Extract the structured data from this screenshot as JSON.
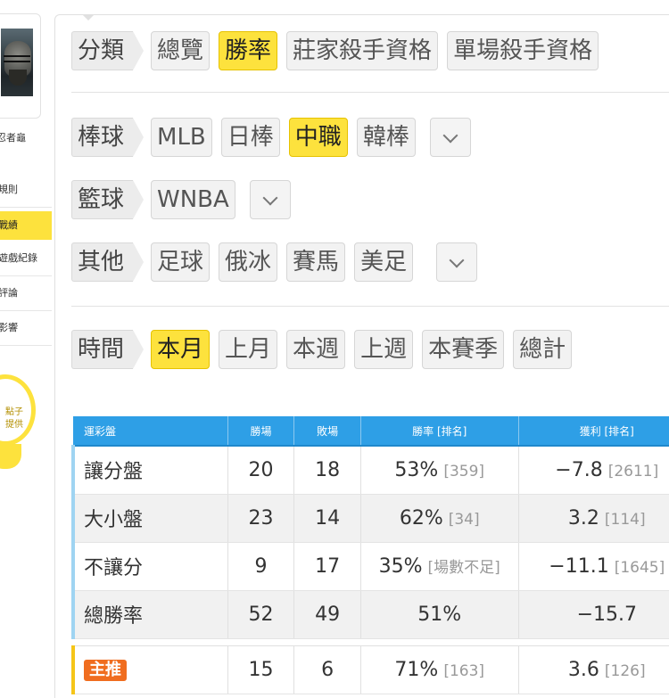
{
  "sidebar": {
    "username": "忍者龜",
    "menu": [
      "規則",
      "戰績",
      "遊戲紀錄",
      "評論",
      "影響"
    ],
    "bulb_text": "點子\n提供"
  },
  "categories": {
    "label": "分類",
    "items": [
      "總覽",
      "勝率",
      "莊家殺手資格",
      "單場殺手資格"
    ],
    "active": "勝率"
  },
  "baseball": {
    "label": "棒球",
    "items": [
      "MLB",
      "日棒",
      "中職",
      "韓棒"
    ],
    "active": "中職"
  },
  "basketball": {
    "label": "籃球",
    "items": [
      "WNBA"
    ]
  },
  "other": {
    "label": "其他",
    "items": [
      "足球",
      "俄冰",
      "賽馬",
      "美足"
    ]
  },
  "time": {
    "label": "時間",
    "items": [
      "本月",
      "上月",
      "本週",
      "上週",
      "本賽季",
      "總計"
    ],
    "active": "本月"
  },
  "table": {
    "headers": [
      "運彩盤",
      "勝場",
      "敗場",
      "勝率 [排名]",
      "獲利 [排名]"
    ],
    "rows": [
      {
        "name": "讓分盤",
        "wins": "20",
        "losses": "18",
        "rate": "53%",
        "rate_rank": "[359]",
        "profit": "−7.8",
        "profit_rank": "[2611]"
      },
      {
        "name": "大小盤",
        "wins": "23",
        "losses": "14",
        "rate": "62%",
        "rate_rank": "[34]",
        "profit": "3.2",
        "profit_rank": "[114]"
      },
      {
        "name": "不讓分",
        "wins": "9",
        "losses": "17",
        "rate": "35%",
        "rate_rank": "[場數不足]",
        "profit": "−11.1",
        "profit_rank": "[1645]"
      },
      {
        "name": "總勝率",
        "wins": "52",
        "losses": "49",
        "rate": "51%",
        "rate_rank": "",
        "profit": "−15.7",
        "profit_rank": ""
      }
    ],
    "featured": {
      "tag": "主推",
      "wins": "15",
      "losses": "6",
      "rate": "71%",
      "rate_rank": "[163]",
      "profit": "3.6",
      "profit_rank": "[126]"
    }
  },
  "colors": {
    "accent": "#fde23d",
    "header": "#2e9fe6",
    "tag": "#f06d1f"
  }
}
